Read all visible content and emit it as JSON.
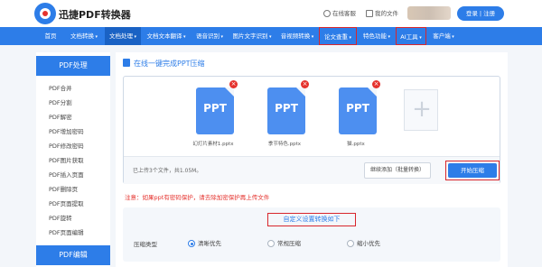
{
  "header": {
    "brand": "迅捷PDF转换器",
    "customer_service": "在线客服",
    "my_files": "我的文件",
    "login": "登录 | 注册"
  },
  "nav": [
    {
      "label": "首页"
    },
    {
      "label": "文档转换"
    },
    {
      "label": "文档处理"
    },
    {
      "label": "文档文本翻译"
    },
    {
      "label": "语音识别"
    },
    {
      "label": "图片文字识别"
    },
    {
      "label": "音视频转换"
    },
    {
      "label": "论文查重"
    },
    {
      "label": "特色功能"
    },
    {
      "label": "AI工具"
    },
    {
      "label": "客户端"
    }
  ],
  "sidebar": {
    "section1": "PDF处理",
    "items": [
      "PDF合并",
      "PDF分割",
      "PDF解密",
      "PDF增加密码",
      "PDF修改密码",
      "PDF图片获取",
      "PDF插入页面",
      "PDF删除页",
      "PDF页面提取",
      "PDF旋转",
      "PDF页面编辑"
    ],
    "section2": "PDF编辑"
  },
  "main": {
    "title": "在线一键完成PPT压缩",
    "files": [
      {
        "type": "PPT",
        "name": "幻灯片素材1.pptx"
      },
      {
        "type": "PPT",
        "name": "季节特色.pptx"
      },
      {
        "type": "PPT",
        "name": "猫.pptx"
      }
    ],
    "add_glyph": "+",
    "upload_info": "已上传3个文件，共1.05M。",
    "continue_label": "继续添加（批量转换）",
    "start_label": "开始压缩",
    "notice": "注意：如果ppt有密码保护，请去除加密保护再上传文件",
    "settings_title": "自定义设置转换如下",
    "mode_label": "压缩类型",
    "modes": [
      {
        "label": "清晰优先",
        "selected": true
      },
      {
        "label": "常规压缩",
        "selected": false
      },
      {
        "label": "缩小优先",
        "selected": false
      }
    ]
  },
  "colors": {
    "accent": "#2d7de8",
    "highlight": "#d8262c",
    "warning": "#e5322d"
  }
}
